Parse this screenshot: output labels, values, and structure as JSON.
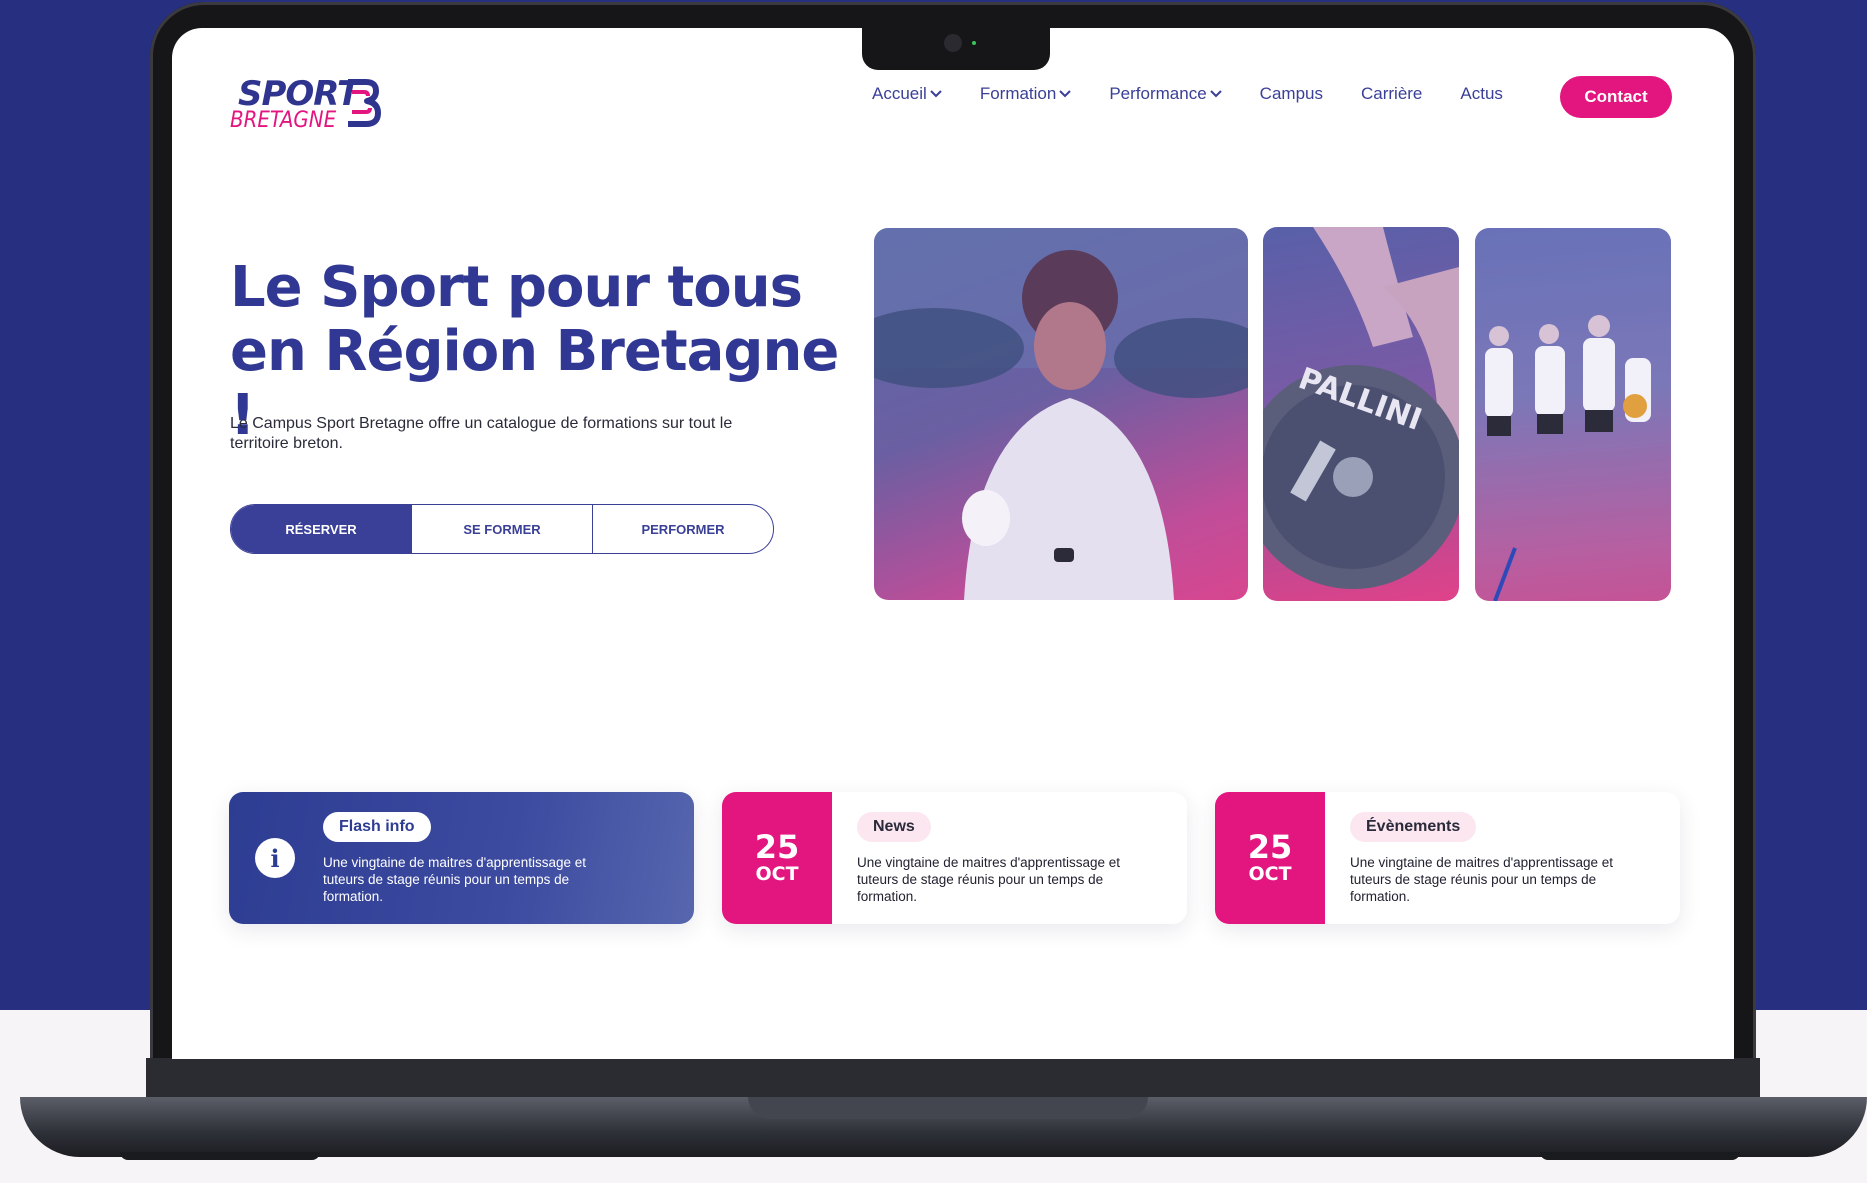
{
  "brand": {
    "name_top": "SPORT",
    "name_bottom": "BRETAGNE",
    "pink": "#e3157e",
    "blue": "#303893"
  },
  "nav": {
    "items": [
      {
        "label": "Accueil",
        "dropdown": true
      },
      {
        "label": "Formation",
        "dropdown": true
      },
      {
        "label": "Performance",
        "dropdown": true
      },
      {
        "label": "Campus",
        "dropdown": false
      },
      {
        "label": "Carrière",
        "dropdown": false
      },
      {
        "label": "Actus",
        "dropdown": false
      }
    ],
    "contact_label": "Contact"
  },
  "hero": {
    "title_line1": "Le Sport pour tous",
    "title_line2": "en Région Bretagne !",
    "description": "Le Campus Sport Bretagne offre un catalogue de formations sur tout le territoire breton.",
    "buttons": [
      "RÉSERVER",
      "SE FORMER",
      "PERFORMER"
    ]
  },
  "cards": {
    "flash": {
      "tag": "Flash info",
      "text": "Une vingtaine de maitres d'apprentissage et tuteurs de stage réunis pour un temps de formation."
    },
    "news": {
      "day": "25",
      "month": "OCT",
      "tag": "News",
      "text": "Une vingtaine de maitres d'apprentissage et tuteurs de stage réunis pour un temps de formation."
    },
    "events": {
      "day": "25",
      "month": "OCT",
      "tag": "Évènements",
      "text": "Une vingtaine de maitres d'apprentissage et tuteurs de stage réunis pour un temps de formation."
    }
  },
  "images": [
    "athlete-discus-photo",
    "barbell-plate-photo",
    "volleyball-team-photo"
  ],
  "decorative_text": {
    "plate_brand": "PALLINI"
  }
}
